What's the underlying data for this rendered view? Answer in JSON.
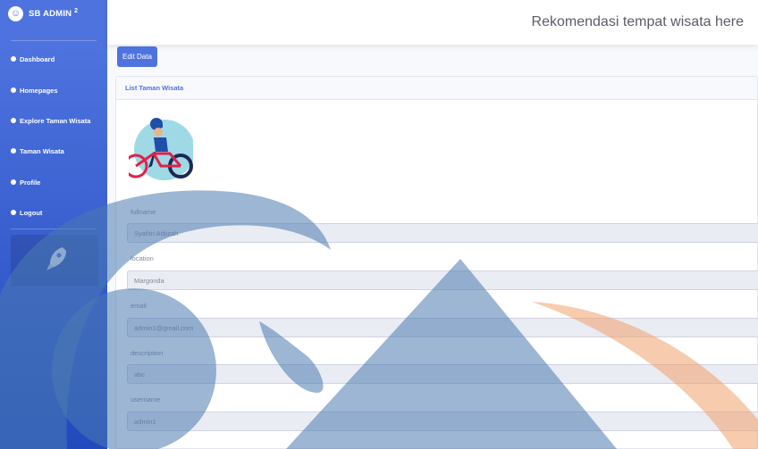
{
  "brand": {
    "title": "SB ADMIN",
    "sup": "2",
    "icon": "laugh-wink-icon"
  },
  "sidebar": {
    "items": [
      {
        "label": "Dashboard",
        "icon": "dashboard-icon"
      },
      {
        "label": "Homepages",
        "icon": "home-icon"
      },
      {
        "label": "Explore Taman Wisata",
        "icon": "explore-icon"
      },
      {
        "label": "Taman Wisata",
        "icon": "park-icon"
      },
      {
        "label": "Profile",
        "icon": "profile-icon"
      },
      {
        "label": "Logout",
        "icon": "logout-icon"
      }
    ],
    "promo_icon": "rocket-icon"
  },
  "topbar": {
    "title": "Rekomendasi tempat wisata here"
  },
  "toolbar": {
    "edit_label": "Edit Data"
  },
  "card": {
    "header": "List Taman Wisata",
    "avatar_icon": "cyclist-avatar-icon",
    "fields": [
      {
        "label": "fullname",
        "value": "Syafitri Adjizah"
      },
      {
        "label": "location",
        "value": "Margonda"
      },
      {
        "label": "email",
        "value": "admin1@gmail.com"
      },
      {
        "label": "description",
        "value": "abc"
      },
      {
        "label": "username",
        "value": "admin1"
      }
    ]
  },
  "colors": {
    "primary": "#4e73df",
    "primary_dark": "#224abe",
    "accent_orange": "#f0a06a"
  }
}
